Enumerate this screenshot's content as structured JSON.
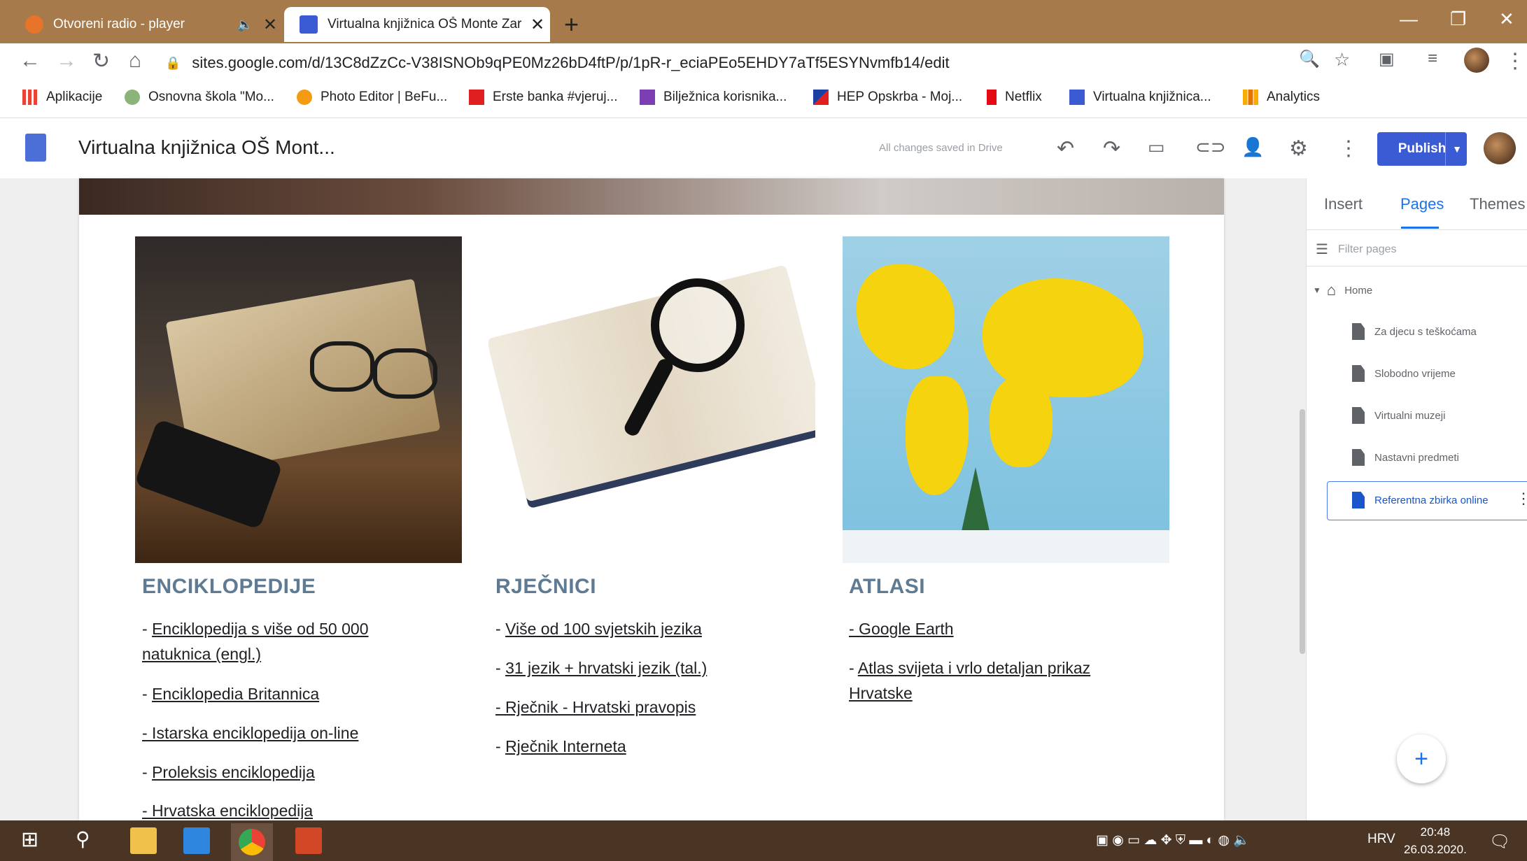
{
  "browser": {
    "tabs": [
      {
        "label": "Otvoreni radio - player",
        "active": false
      },
      {
        "label": "Virtualna knjižnica OŠ Monte Zar",
        "active": true
      }
    ],
    "url": "sites.google.com/d/13C8dZzCc-V38ISNOb9qPE0Mz26bD4ftP/p/1pR-r_eciaPEo5EHDY7aTf5ESYNvmfb14/edit",
    "bookmarks": [
      {
        "label": "Aplikacije"
      },
      {
        "label": "Osnovna škola \"Mo..."
      },
      {
        "label": "Photo Editor | BeFu..."
      },
      {
        "label": "Erste banka #vjeruj..."
      },
      {
        "label": "Bilježnica korisnika..."
      },
      {
        "label": "HEP Opskrba - Moj..."
      },
      {
        "label": "Netflix"
      },
      {
        "label": "Virtualna knjižnica..."
      },
      {
        "label": "Analytics"
      }
    ]
  },
  "sites": {
    "title": "Virtualna knjižnica OŠ Mont...",
    "saved_status": "All changes saved in Drive",
    "publish_label": "Publish",
    "panel_tabs": [
      {
        "label": "Insert"
      },
      {
        "label": "Pages"
      },
      {
        "label": "Themes"
      }
    ],
    "filter_placeholder": "Filter pages",
    "pages": [
      {
        "label": "Home"
      },
      {
        "label": "Za djecu s teškoćama"
      },
      {
        "label": "Slobodno vrijeme"
      },
      {
        "label": "Virtualni muzeji"
      },
      {
        "label": "Nastavni predmeti"
      },
      {
        "label": "Referentna zbirka online"
      }
    ],
    "selected_page": "Referentna zbirka online"
  },
  "content": {
    "columns": [
      {
        "title": "ENCIKLOPEDIJE",
        "links": [
          {
            "prefix": " - ",
            "text": "Enciklopedija s više od 50 000 natuknica (engl.)"
          },
          {
            "prefix": " - ",
            "text": "Enciklopedia Britannica "
          },
          {
            "prefix": "",
            "text": "-  Istarska enciklopedija on-line"
          },
          {
            "prefix": "- ",
            "text": "Proleksis enciklopedija "
          },
          {
            "prefix": "",
            "text": "- Hrvatska enciklopedija"
          }
        ]
      },
      {
        "title": "RJEČNICI",
        "links": [
          {
            "prefix": " - ",
            "text": "Više od 100 svjetskih jezika "
          },
          {
            "prefix": "- ",
            "text": "31 jezik + hrvatski jezik (tal.)"
          },
          {
            "prefix": "",
            "text": "-  Rječnik - Hrvatski pravopis"
          },
          {
            "prefix": "- ",
            "text": "Rječnik Interneta"
          }
        ]
      },
      {
        "title": "ATLASI",
        "links": [
          {
            "prefix": "",
            "text": "- Google Earth "
          },
          {
            "prefix": "- ",
            "text": "Atlas svijeta i vrlo detaljan prikaz Hrvatske"
          }
        ]
      }
    ]
  },
  "taskbar": {
    "language": "HRV",
    "time": "20:48",
    "date": "26.03.2020."
  }
}
